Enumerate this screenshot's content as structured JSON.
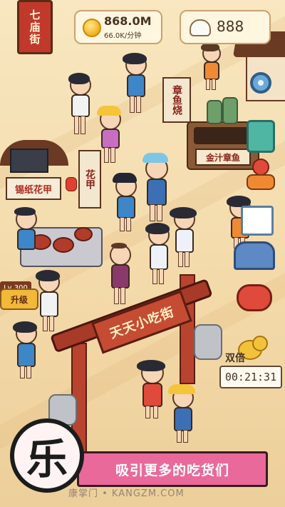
{
  "hud": {
    "shop_sign": "七庙街",
    "coins_amount": "868.0M",
    "coins_rate": "66.0K/分钟",
    "buns_amount": "888"
  },
  "stalls": {
    "noodle_banner": "花甲",
    "noodle_sign": "锡纸花甲",
    "octopus_banner": "章鱼烧",
    "octopus_sign": "金汁章鱼",
    "level": "Lv 300",
    "upgrade_label": "升级"
  },
  "gate": {
    "plaque": "天天小吃街"
  },
  "events": {
    "double_label": "双倍",
    "timer": "00:21:31"
  },
  "promo": {
    "slogan": "吸引更多的吃货们",
    "watermark": "康掌门 • KANGZM.COM"
  },
  "icons": [
    "settings-gear-icon",
    "clipboard-icon",
    "courier-icon",
    "calendar-icon",
    "mailbox-icon",
    "lion-dance-icon",
    "coin-stack-icon",
    "coin-icon",
    "bun-icon"
  ],
  "colors": {
    "slogan_bg": "#e9699a",
    "gate_red": "#b8442f",
    "panel_bg": "#fff6df"
  }
}
